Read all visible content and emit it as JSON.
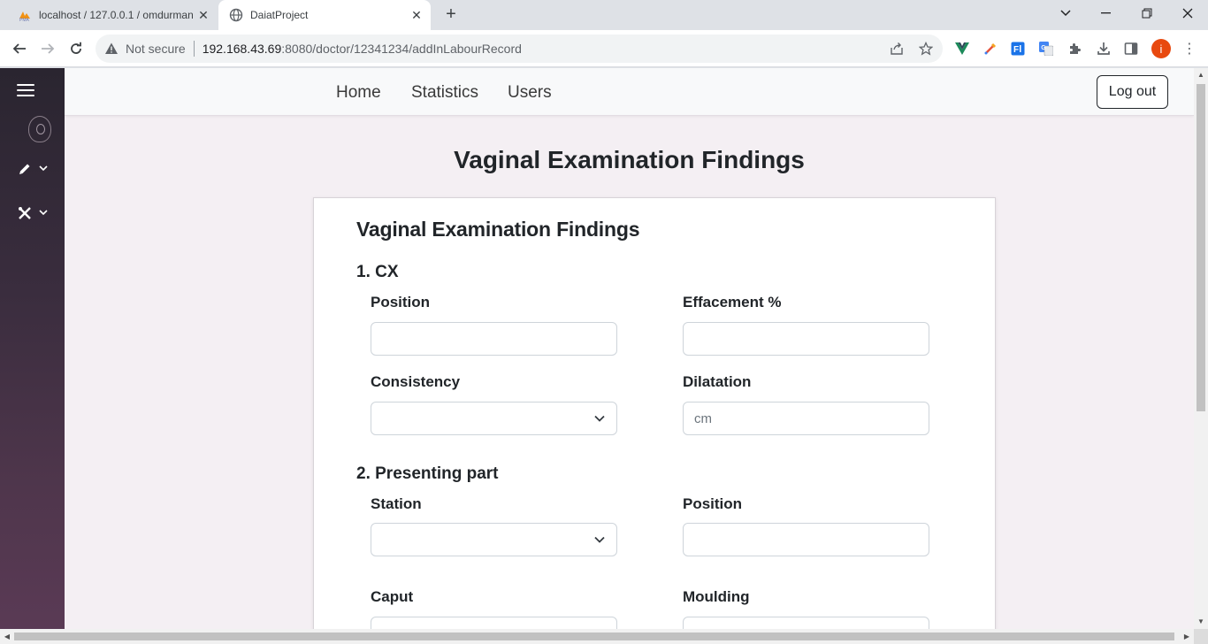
{
  "browser": {
    "tabs": [
      {
        "title": "localhost / 127.0.0.1 / omdurman",
        "icon": "phpmyadmin-icon",
        "active": false
      },
      {
        "title": "DaiatProject",
        "icon": "globe-icon",
        "active": true
      }
    ],
    "security_label": "Not secure",
    "url_host": "192.168.43.69",
    "url_path": ":8080/doctor/12341234/addInLabourRecord",
    "profile_initial": "i",
    "profile_color": "#e8490f"
  },
  "nav": {
    "links": [
      "Home",
      "Statistics",
      "Users"
    ],
    "logout_label": "Log out"
  },
  "page": {
    "title": "Vaginal Examination Findings"
  },
  "form": {
    "title": "Vaginal Examination Findings",
    "sections": [
      {
        "title": "1. CX",
        "fields": [
          {
            "label": "Position",
            "type": "text",
            "value": "",
            "placeholder": ""
          },
          {
            "label": "Effacement %",
            "type": "text",
            "value": "",
            "placeholder": ""
          },
          {
            "label": "Consistency",
            "type": "select",
            "value": ""
          },
          {
            "label": "Dilatation",
            "type": "text",
            "value": "",
            "placeholder": "cm"
          }
        ]
      },
      {
        "title": "2. Presenting part",
        "fields": [
          {
            "label": "Station",
            "type": "select",
            "value": ""
          },
          {
            "label": "Position",
            "type": "text",
            "value": "",
            "placeholder": ""
          },
          {
            "label": "Caput",
            "type": "text",
            "value": "",
            "placeholder": ""
          },
          {
            "label": "Moulding",
            "type": "text",
            "value": "",
            "placeholder": ""
          }
        ]
      }
    ]
  }
}
